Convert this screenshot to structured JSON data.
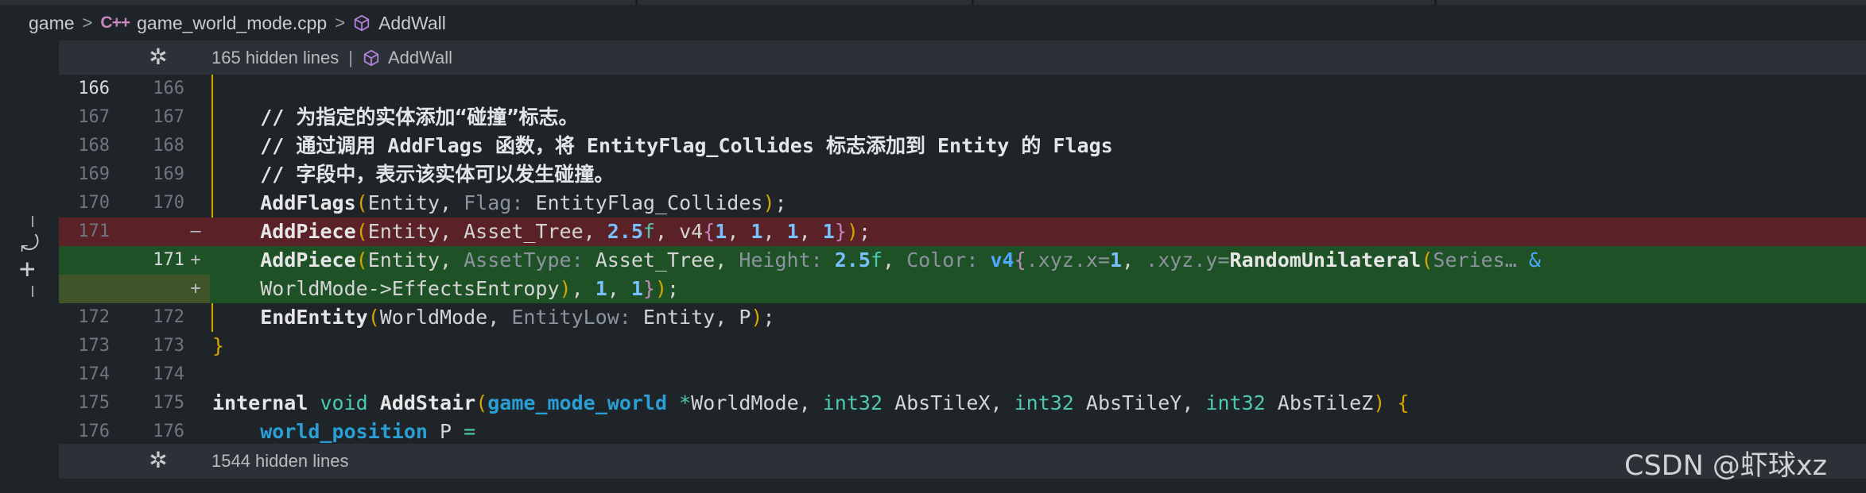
{
  "breadcrumb": {
    "root": "game",
    "file_icon": "cpp-file-icon",
    "file_icon_glyph": "C++",
    "file": "game_world_mode.cpp",
    "symbol": "AddWall",
    "separator": ">"
  },
  "hidden_top": {
    "text": "165 hidden lines",
    "pipe": "|",
    "symbol": "AddWall"
  },
  "hidden_bottom": {
    "text": "1544 hidden lines"
  },
  "lines": {
    "r166": {
      "old": "166",
      "new": "166"
    },
    "r167": {
      "old": "167",
      "new": "167",
      "code": "    // 为指定的实体添加“碰撞”标志。"
    },
    "r168": {
      "old": "168",
      "new": "168",
      "code": "    // 通过调用 AddFlags 函数，将 EntityFlag_Collides 标志添加到 Entity 的 Flags"
    },
    "r169": {
      "old": "169",
      "new": "169",
      "code": "    // 字段中，表示该实体可以发生碰撞。"
    },
    "r170": {
      "old": "170",
      "new": "170"
    },
    "r171d": {
      "old": "171",
      "mark": "–"
    },
    "r171a": {
      "new": "171",
      "mark": "+"
    },
    "r171b": {
      "mark": "+"
    },
    "r172": {
      "old": "172",
      "new": "172"
    },
    "r173": {
      "old": "173",
      "new": "173"
    },
    "r174": {
      "old": "174",
      "new": "174"
    },
    "r175": {
      "old": "175",
      "new": "175"
    },
    "r176": {
      "old": "176",
      "new": "176"
    }
  },
  "code": {
    "addflags": {
      "fn": "AddFlags",
      "a1": "Entity",
      "hint": "Flag:",
      "a2": "EntityFlag_Collides",
      "end": ");"
    },
    "del": {
      "fn": "AddPiece",
      "a1": "Entity",
      "a2": "Asset_Tree",
      "n": "2.5",
      "f": "f",
      "v4": "v4",
      "n1": "1",
      "n2": "1",
      "n3": "1",
      "n4": "1",
      "end": ");"
    },
    "add": {
      "fn": "AddPiece",
      "a1": "Entity",
      "h1": "AssetType:",
      "a2": "Asset_Tree",
      "h2": "Height:",
      "n": "2.5",
      "f": "f",
      "h3": "Color:",
      "v4": "v4",
      "h4": ".xyz.x=",
      "n1": "1",
      "h5": ".xyz.y=",
      "rnd": "RandomUnilateral",
      "h6": "Series…",
      "amp": "&",
      "cont": "WorldMode->EffectsEntropy",
      "n3": "1",
      "n4": "1",
      "end": ");"
    },
    "endentity": {
      "fn": "EndEntity",
      "a1": "WorldMode",
      "hint": "EntityLow:",
      "a2": "Entity",
      "a3": "P",
      "end": ");"
    },
    "close": "}",
    "addstair": {
      "kw": "internal",
      "ret": "void",
      "fn": "AddStair",
      "t1": "game_mode_world",
      "star": "*",
      "p1": "WorldMode",
      "t2": "int32",
      "p2": "AbsTileX",
      "t3": "int32",
      "p3": "AbsTileY",
      "t4": "int32",
      "p4": "AbsTileZ",
      "open": "{"
    },
    "wpos": {
      "t": "world_position",
      "v": "P",
      "eq": "="
    }
  },
  "gutter": {
    "dash_icon": "dash-icon",
    "revert_icon": "revert-icon",
    "revert_glyph": "⤾",
    "add_icon": "add-icon",
    "add_glyph": "+"
  },
  "expand_icon_glyph": "✲",
  "watermark": "CSDN @虾球xz",
  "colors": {
    "deleted_bg": "#5a2226",
    "added_bg": "#1f5126",
    "guide": "#d7a500"
  }
}
